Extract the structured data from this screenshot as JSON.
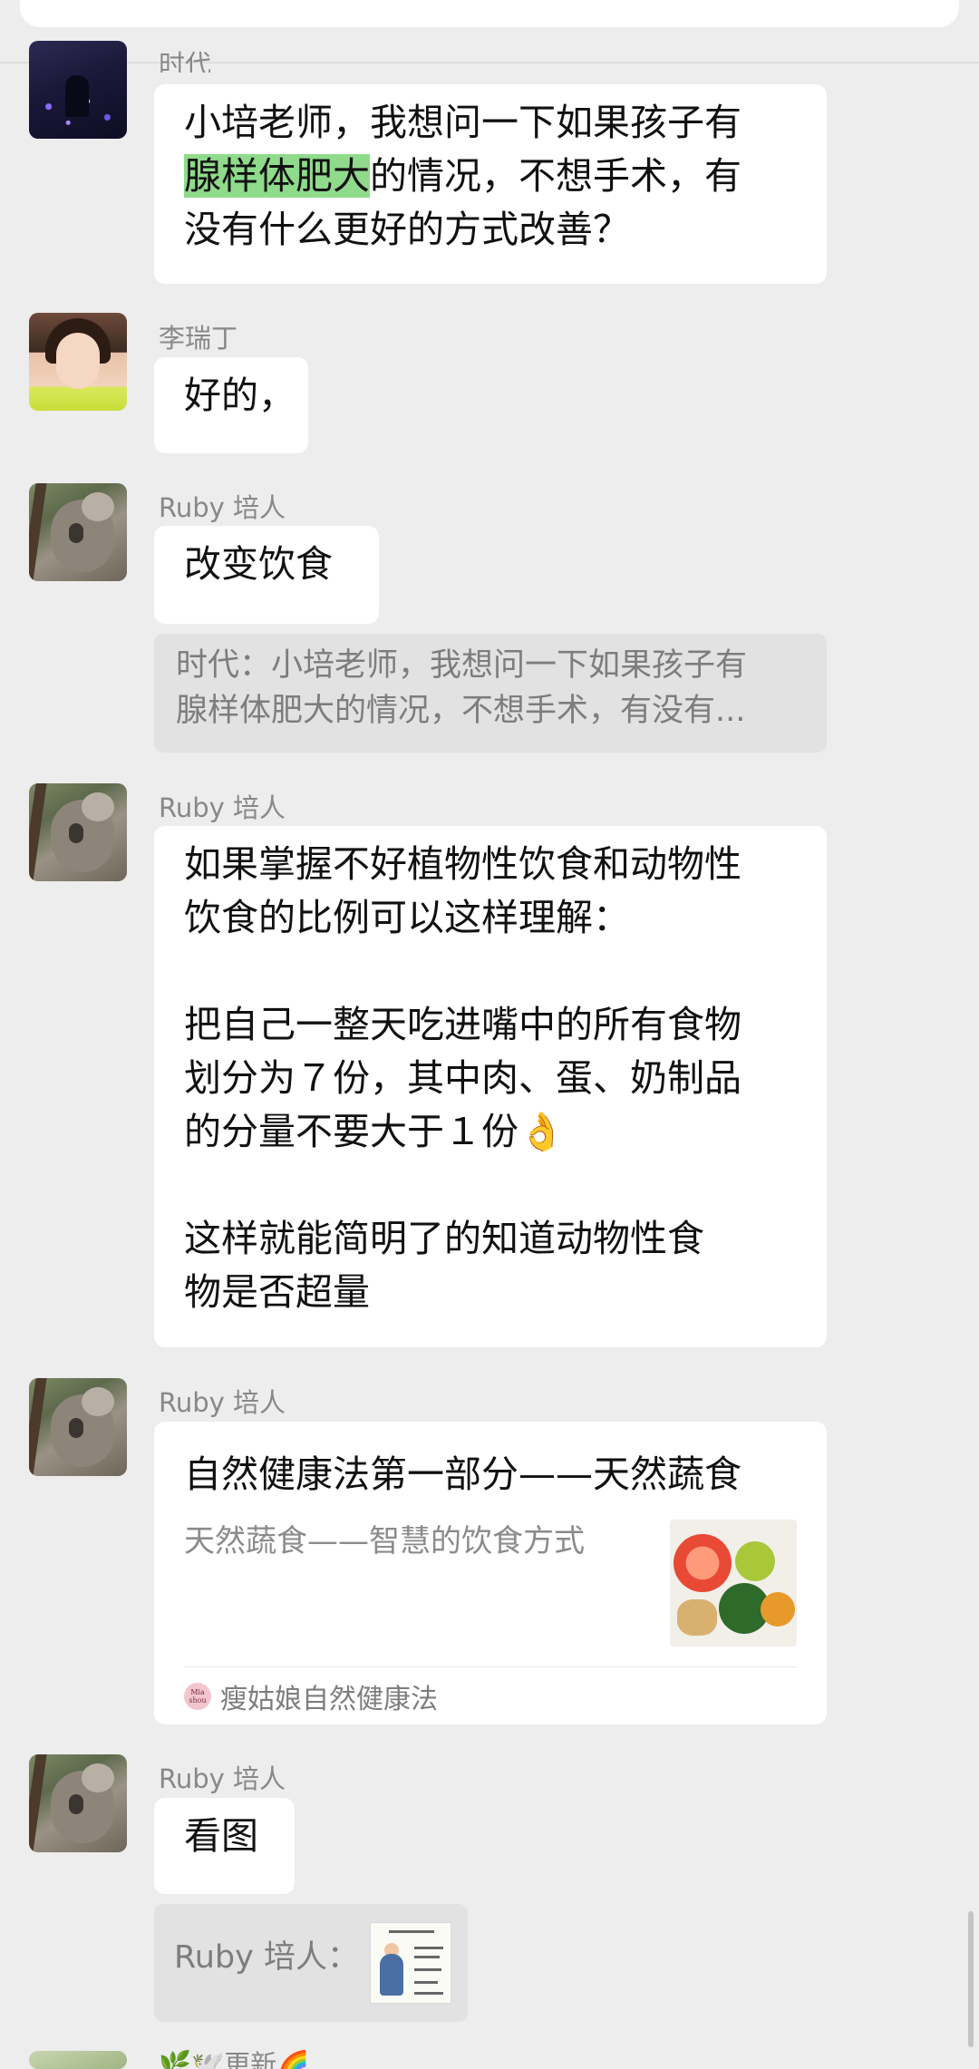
{
  "messages": [
    {
      "sender": "时代",
      "lines": [
        {
          "pre": "小培老师，我想问一下如果孩子有",
          "hl": "",
          "post": ""
        },
        {
          "pre": "",
          "hl": "腺样体肥大",
          "post": "的情况，不想手术，有"
        },
        {
          "pre": "没有什么更好的方式改善？",
          "hl": "",
          "post": ""
        }
      ]
    },
    {
      "sender": "李瑞丁",
      "lines": [
        "好的，"
      ]
    },
    {
      "sender": "Ruby 培人",
      "lines": [
        "改变饮食"
      ],
      "quote": [
        "时代：小培老师，我想问一下如果孩子有",
        "腺样体肥大的情况，不想手术，有没有..."
      ]
    },
    {
      "sender": "Ruby 培人",
      "lines": [
        "如果掌握不好植物性饮食和动物性",
        "饮食的比例可以这样理解：",
        "",
        "把自己一整天吃进嘴中的所有食物",
        "划分为７份，其中肉、蛋、奶制品",
        "的分量不要大于１份👌",
        "",
        "这样就能简明了的知道动物性食",
        "物是否超量"
      ]
    },
    {
      "sender": "Ruby 培人",
      "link_card": {
        "title": "自然健康法第一部分——天然蔬食",
        "description": "天然蔬食——智慧的饮食方式",
        "source_logo_text": "Mia shou",
        "source": "瘦姑娘自然健康法"
      }
    },
    {
      "sender": "Ruby 培人",
      "lines": [
        "看图"
      ],
      "image_quote": {
        "label": "Ruby 培人："
      }
    }
  ],
  "bottom_sender": "🌿🕊️更新🌈"
}
